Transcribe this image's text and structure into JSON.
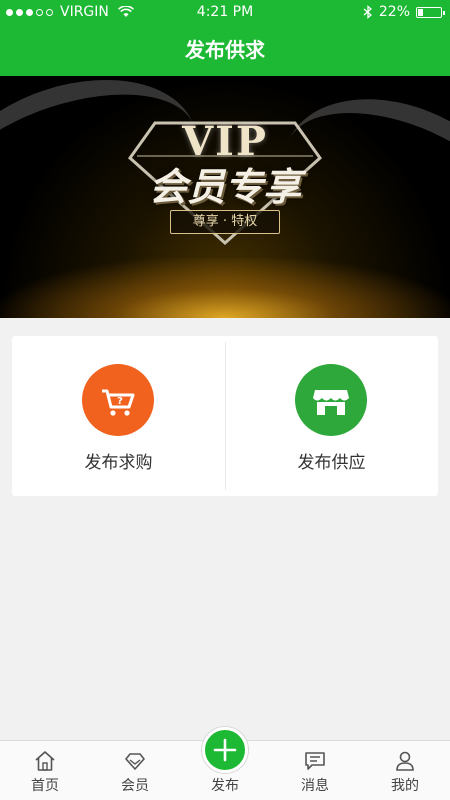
{
  "status_bar": {
    "carrier": "VIRGIN",
    "time": "4:21 PM",
    "battery": "22%",
    "battery_level": 0.22,
    "signal_dots_filled": 3,
    "signal_dots_total": 5
  },
  "header": {
    "title": "发布供求",
    "background_color": "#1db934"
  },
  "banner": {
    "headline": "VIP",
    "subtitle": "会员专享",
    "tag": "尊享 · 特权"
  },
  "actions": [
    {
      "label": "发布求购",
      "icon": "shopping-cart-icon",
      "color": "#f0621e"
    },
    {
      "label": "发布供应",
      "icon": "storefront-icon",
      "color": "#2ea83a"
    }
  ],
  "tabs": [
    {
      "label": "首页",
      "icon": "home-icon"
    },
    {
      "label": "会员",
      "icon": "diamond-icon"
    },
    {
      "label": "发布",
      "icon": "plus-icon"
    },
    {
      "label": "消息",
      "icon": "message-icon"
    },
    {
      "label": "我的",
      "icon": "user-icon"
    }
  ]
}
